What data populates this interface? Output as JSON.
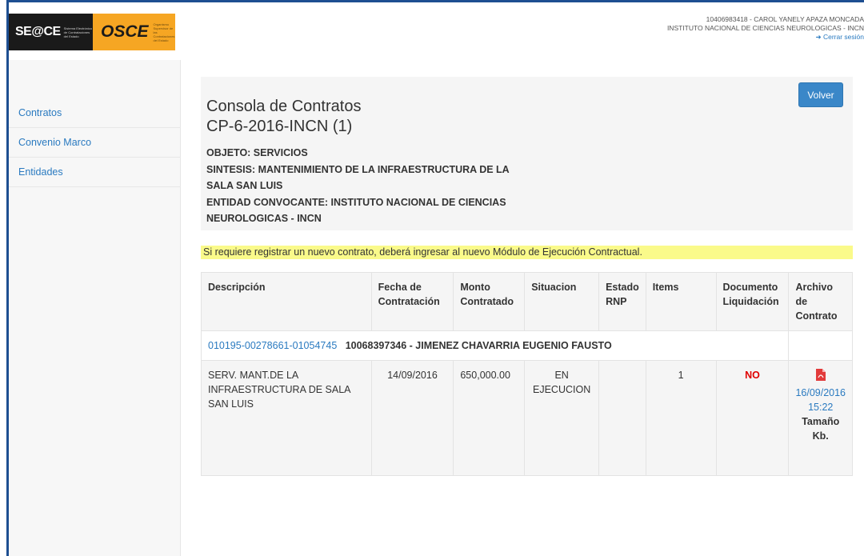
{
  "header": {
    "seace_logo": "SE@CE",
    "seace_sub": "Sistema Electrónico de Contrataciones del Estado",
    "osce_logo": "OSCE",
    "osce_sub": "Organismo Supervisor de las Contrataciones del Estado",
    "user_line": "10406983418 - CAROL YANELY APAZA MONCADA",
    "entity_line": "INSTITUTO NACIONAL DE CIENCIAS NEUROLOGICAS - INCN",
    "logout": "Cerrar sesión"
  },
  "sidebar": {
    "items": [
      {
        "label": "Contratos"
      },
      {
        "label": "Convenio Marco"
      },
      {
        "label": "Entidades"
      }
    ]
  },
  "panel": {
    "title": "Consola de Contratos",
    "code": "CP-6-2016-INCN (1)",
    "objeto": "OBJETO: SERVICIOS",
    "sintesis": "SINTESIS: MANTENIMIENTO DE LA INFRAESTRUCTURA DE LA SALA SAN LUIS",
    "entidad": "ENTIDAD CONVOCANTE: INSTITUTO NACIONAL DE CIENCIAS NEUROLOGICAS - INCN",
    "back_button": "Volver"
  },
  "notice": "Si requiere registrar un nuevo contrato, deberá ingresar al nuevo Módulo de Ejecución Contractual.",
  "table": {
    "headers": {
      "descripcion": "Descripción",
      "fecha": "Fecha de Contratación",
      "monto": "Monto Contratado",
      "situacion": "Situacion",
      "estado": "Estado RNP",
      "items": "Items",
      "documento": "Documento Liquidación",
      "archivo": "Archivo de Contrato"
    },
    "group": {
      "link": "010195-00278661-01054745",
      "contractor": "10068397346 - JIMENEZ CHAVARRIA EUGENIO FAUSTO"
    },
    "row": {
      "descripcion": "SERV. MANT.DE LA INFRAESTRUCTURA DE SALA SAN LUIS",
      "fecha": "14/09/2016",
      "monto": "650,000.00",
      "situacion": "EN EJECUCION",
      "estado": "",
      "items": "1",
      "documento": "NO",
      "archivo_fecha": "16/09/2016",
      "archivo_hora": "15:22",
      "tamano": "Tamaño Kb."
    }
  },
  "icons": {
    "pdf": "pdf-file-icon",
    "logout": "logout-arrow-icon"
  },
  "colors": {
    "link": "#2a7ac0",
    "button": "#3a87c8",
    "notice_bg": "#fafa8a",
    "alert": "#e00000",
    "frame": "#1e4f91"
  }
}
